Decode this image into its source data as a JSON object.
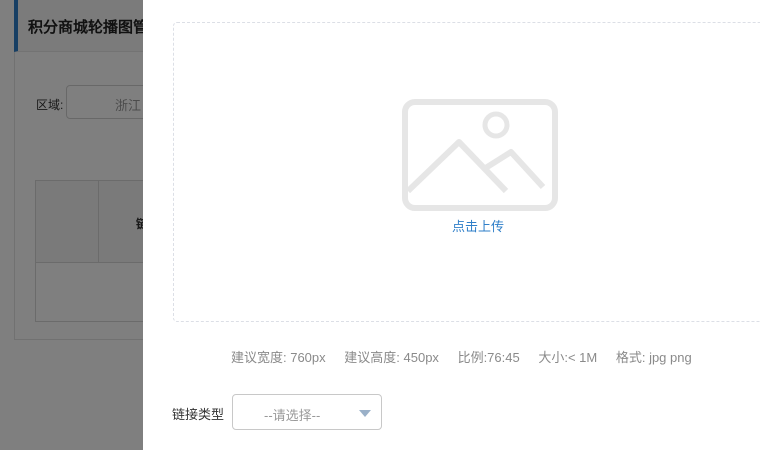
{
  "background": {
    "page_title": "积分商城轮播图管理",
    "region_label": "区域:",
    "region_value": "浙江",
    "table_header_partial": "链"
  },
  "dialog": {
    "upload": {
      "action_text": "点击上传",
      "icon": "image-placeholder-icon"
    },
    "hints": {
      "width": "建议宽度: 760px",
      "height": "建议高度: 450px",
      "ratio": "比例:76:45",
      "size": "大小:< 1M",
      "format": "格式: jpg png"
    },
    "link_type": {
      "label": "链接类型",
      "placeholder": "--请选择--"
    }
  },
  "colors": {
    "accent": "#2f7fc9",
    "overlay": "rgba(0,0,0,0.5)",
    "icon_gray": "#e6e6e6"
  }
}
